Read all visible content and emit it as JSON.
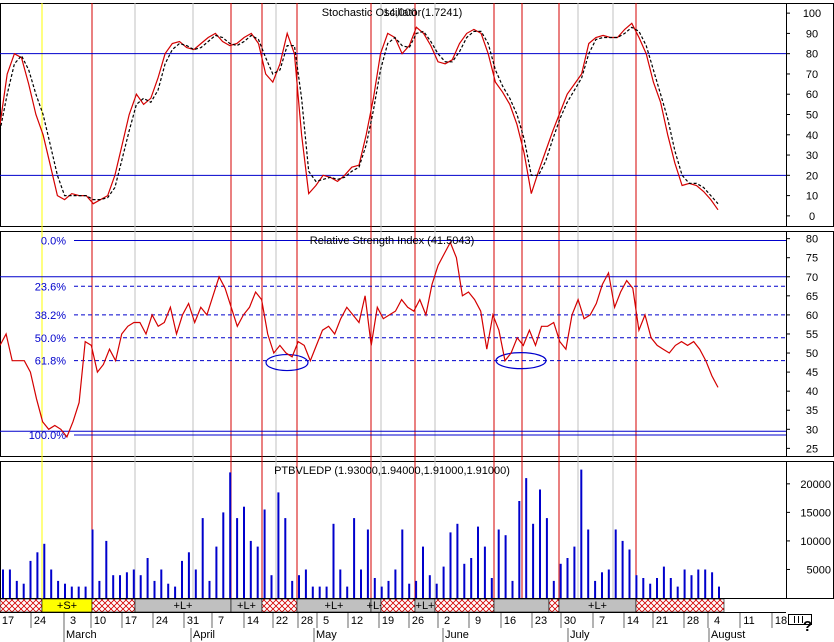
{
  "chart_data": {
    "type": "line",
    "dates": {
      "day_labels": [
        "17",
        "24",
        "3",
        "10",
        "17",
        "24",
        "31",
        "7",
        "14",
        "22",
        "28",
        "5",
        "12",
        "19",
        "26",
        "2",
        "9",
        "16",
        "23",
        "30",
        "7",
        "14",
        "21",
        "28",
        "4",
        "11",
        "18"
      ],
      "month_labels": [
        "March",
        "April",
        "May",
        "June",
        "July",
        "August"
      ]
    },
    "panels": [
      {
        "id": "stochastic",
        "title": "Stochastic Oscillator(1.7241)",
        "title_overlay": "14,000",
        "y_ticks": [
          0,
          10,
          20,
          30,
          40,
          50,
          60,
          70,
          80,
          90,
          100
        ],
        "ylim": [
          -5,
          105
        ],
        "h_lines": [
          20,
          80
        ],
        "series": [
          {
            "color": "#d40000",
            "style": "solid",
            "values": [
              45,
              70,
              80,
              78,
              65,
              50,
              40,
              25,
              10,
              8,
              11,
              10,
              10,
              6,
              8,
              10,
              20,
              35,
              50,
              60,
              55,
              58,
              68,
              80,
              85,
              86,
              83,
              82,
              85,
              88,
              90,
              86,
              84,
              85,
              88,
              90,
              85,
              70,
              66,
              75,
              90,
              80,
              40,
              11,
              15,
              20,
              19,
              17,
              20,
              24,
              25,
              40,
              58,
              80,
              90,
              88,
              80,
              84,
              93,
              90,
              84,
              76,
              75,
              77,
              85,
              90,
              92,
              90,
              80,
              66,
              61,
              55,
              45,
              31,
              11,
              22,
              32,
              42,
              51,
              60,
              65,
              70,
              85,
              88,
              89,
              88,
              88,
              92,
              95,
              88,
              80,
              66,
              56,
              40,
              26,
              15,
              16,
              15,
              12,
              8,
              3
            ]
          },
          {
            "color": "#000000",
            "style": "dashed",
            "values": [
              42,
              60,
              75,
              79,
              72,
              60,
              50,
              35,
              20,
              10,
              10,
              10,
              10,
              8,
              8,
              9,
              14,
              28,
              42,
              55,
              58,
              56,
              62,
              75,
              82,
              85,
              84,
              82,
              83,
              86,
              89,
              88,
              85,
              84,
              86,
              89,
              87,
              78,
              70,
              72,
              84,
              84,
              58,
              22,
              17,
              18,
              19,
              18,
              19,
              22,
              24,
              35,
              52,
              72,
              85,
              88,
              84,
              83,
              90,
              91,
              86,
              80,
              76,
              76,
              81,
              88,
              91,
              91,
              85,
              72,
              64,
              58,
              50,
              38,
              20,
              20,
              27,
              38,
              48,
              56,
              62,
              68,
              80,
              87,
              88,
              88,
              88,
              90,
              93,
              91,
              84,
              72,
              60,
              48,
              32,
              20,
              16,
              16,
              14,
              10,
              6
            ]
          }
        ]
      },
      {
        "id": "rsi",
        "title": "Relative Strength Index (41.5043)",
        "y_ticks": [
          25,
          30,
          35,
          40,
          45,
          50,
          55,
          60,
          65,
          70,
          75,
          80
        ],
        "ylim": [
          23,
          82
        ],
        "h_lines": [
          29.5,
          70
        ],
        "fib_levels": [
          {
            "label": "0.0%",
            "value": 79.5,
            "style": "solid"
          },
          {
            "label": "23.6%",
            "value": 67.5,
            "style": "dashed"
          },
          {
            "label": "38.2%",
            "value": 60,
            "style": "dashed"
          },
          {
            "label": "50.0%",
            "value": 54,
            "style": "dashed"
          },
          {
            "label": "61.8%",
            "value": 48,
            "style": "dashed"
          },
          {
            "label": "100.0%",
            "value": 28.5,
            "style": "solid"
          }
        ],
        "series": [
          {
            "color": "#d40000",
            "style": "solid",
            "values": [
              52,
              55,
              48,
              48,
              48,
              45,
              38,
              32,
              30,
              31,
              30,
              28,
              32,
              37,
              53,
              52,
              45,
              47,
              51,
              48,
              55,
              57,
              58,
              58,
              55,
              60,
              57,
              58,
              62,
              55,
              60,
              63,
              58,
              62,
              60,
              65,
              70,
              67,
              62,
              57,
              60,
              62,
              66,
              64,
              55,
              50,
              52,
              50,
              49,
              53,
              52,
              48,
              52,
              56,
              57,
              55,
              59,
              62,
              60,
              58,
              65,
              52,
              62,
              59,
              60,
              61,
              64,
              62,
              61,
              64,
              60,
              68,
              73,
              76,
              79,
              75,
              65,
              66,
              64,
              61,
              51,
              60,
              56,
              48,
              50,
              54,
              52,
              56,
              52,
              57,
              57,
              58,
              53,
              51,
              60,
              64,
              59,
              60,
              63,
              68,
              71,
              62,
              66,
              69,
              67,
              56,
              60,
              54,
              52,
              51,
              50,
              52,
              53,
              52,
              53,
              51,
              48,
              44,
              41
            ]
          }
        ],
        "ellipse_labels": []
      },
      {
        "id": "volume",
        "title": "PTBVLEDP (1.93000,1.94000,1.91000,1.91000)",
        "y_ticks": [
          5000,
          10000,
          15000,
          20000
        ],
        "ylim": [
          0,
          24000
        ],
        "bar_color": "#0000cc",
        "values": [
          5000,
          5000,
          3000,
          2500,
          6500,
          8000,
          9500,
          5000,
          3000,
          2500,
          2000,
          2000,
          2000,
          12000,
          3000,
          10000,
          4000,
          4000,
          4500,
          5000,
          4000,
          7000,
          3000,
          5000,
          2500,
          2000,
          6500,
          8000,
          5000,
          14000,
          3000,
          9000,
          15000,
          22000,
          14000,
          16000,
          10000,
          9000,
          15500,
          4000,
          18500,
          14000,
          3000,
          4000,
          5000,
          2000,
          2000,
          2000,
          13000,
          5000,
          2000,
          14000,
          5000,
          12000,
          3500,
          2000,
          3000,
          5000,
          12000,
          2500,
          3000,
          9000,
          4000,
          2500,
          5500,
          11500,
          13000,
          6000,
          7000,
          12500,
          9000,
          3500,
          12000,
          11000,
          3000,
          17000,
          21000,
          13000,
          19000,
          14000,
          3000,
          6000,
          7000,
          9000,
          22500,
          12000,
          3000,
          4500,
          5000,
          12000,
          10000,
          8500,
          4000,
          3500,
          2500,
          3500,
          5500,
          3500,
          2000,
          5000,
          4000,
          5000,
          5000,
          4500,
          2000
        ]
      }
    ],
    "event_markers": {
      "red_vertical_line_dates": [
        "13 Mar",
        "10 Apr",
        "17 Apr",
        "24 Apr",
        "13 May",
        "23 May",
        "1 Jun",
        "13 Jun",
        "25 Jun",
        "3 Jul",
        "15 Jul"
      ],
      "yellow_vertical_line_date": "26 Feb",
      "gray_vertical_line_dates": [
        "20 Mar",
        "3 Apr",
        "25 Apr",
        "16 May",
        "30 May",
        "28 Jun",
        "4 Jul"
      ]
    },
    "signal_bar": {
      "segments": [
        {
          "label": "",
          "kind": "hatch"
        },
        {
          "label": "+S+",
          "kind": "yellow"
        },
        {
          "label": "",
          "kind": "hatch"
        },
        {
          "label": "+L+",
          "kind": "gray"
        },
        {
          "label": "+L+",
          "kind": "gray"
        },
        {
          "label": "",
          "kind": "hatch"
        },
        {
          "label": "+L+",
          "kind": "gray"
        },
        {
          "label": "+L+",
          "kind": "gray"
        },
        {
          "label": "",
          "kind": "hatch"
        },
        {
          "label": "+L+",
          "kind": "gray"
        },
        {
          "label": "",
          "kind": "hatch"
        },
        {
          "label": "",
          "kind": "gray"
        },
        {
          "label": "",
          "kind": "hatch"
        },
        {
          "label": "+L+",
          "kind": "gray"
        },
        {
          "label": "",
          "kind": "hatch"
        }
      ]
    },
    "colors": {
      "price_line": "#d40000",
      "signal_line": "#000000",
      "reference_line": "#0000cc",
      "fib_label": "#0000cc",
      "event_line": "#d40000",
      "start_line": "#ffff00",
      "volume_bar": "#0000cc"
    }
  },
  "footer": {
    "help_glyph": "?"
  },
  "icons": {
    "help": "question-mark-icon",
    "scroll": "mini-scrollbar-icon"
  }
}
